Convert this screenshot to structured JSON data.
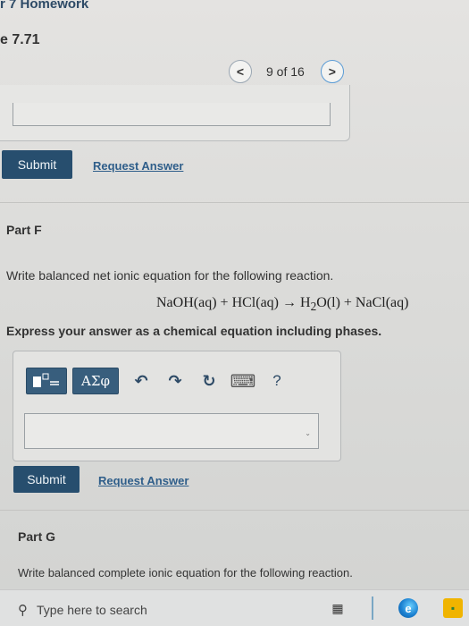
{
  "header": {
    "assignment_title": "r 7 Homework",
    "problem_title": "e 7.71"
  },
  "pager": {
    "prev_symbol": "<",
    "counter_text": "9 of 16",
    "next_symbol": ">"
  },
  "previous_part": {
    "submit_label": "Submit",
    "request_answer_label": "Request Answer"
  },
  "part_f": {
    "label": "Part F",
    "question": "Write balanced net ionic equation for the following reaction.",
    "equation": {
      "lhs1": "NaOH(aq)",
      "plus1": "+",
      "lhs2": "HCl(aq)",
      "arrow": "→",
      "rhs1_pre": "H",
      "rhs1_sub": "2",
      "rhs1_post": "O(l)",
      "plus2": "+",
      "rhs2": "NaCl(aq)"
    },
    "instruction": "Express your answer as a chemical equation including phases.",
    "toolbar": {
      "greek_label": "ΑΣφ",
      "undo_icon": "↶",
      "redo_icon": "↷",
      "reset_icon": "↻",
      "keyboard_icon": "⌨",
      "help_label": "?"
    },
    "answer_value": "",
    "submit_label": "Submit",
    "request_answer_label": "Request Answer"
  },
  "part_g": {
    "label": "Part G",
    "question": "Write balanced complete ionic equation for the following reaction."
  },
  "taskbar": {
    "search_placeholder": "Type here to search",
    "icons": [
      "search-icon",
      "task-view-icon",
      "edge-icon",
      "store-icon"
    ]
  },
  "colors": {
    "accent_button": "#274e6e",
    "link": "#2f5e8a",
    "title": "#2d4a66"
  }
}
